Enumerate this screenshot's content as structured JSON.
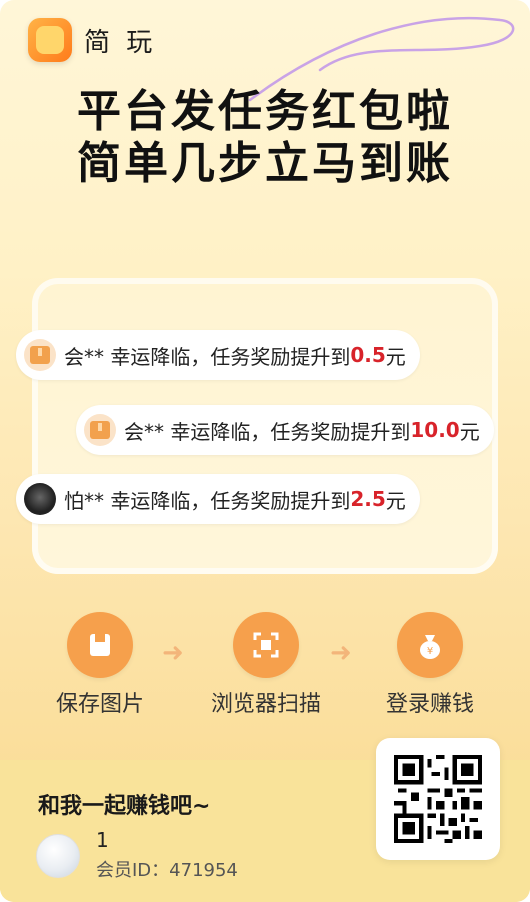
{
  "brand": {
    "name": "简 玩",
    "logo_icon": "app-logo-icon"
  },
  "headline": {
    "line1": "平台发任务红包啦",
    "line2": "简单几步立马到账"
  },
  "notifications": [
    {
      "icon": "package-icon",
      "text": "会** 幸运降临，任务奖励提升到",
      "amount": "0.5",
      "unit": "元"
    },
    {
      "icon": "package-icon",
      "text": "会** 幸运降临，任务奖励提升到",
      "amount": "10.0",
      "unit": "元"
    },
    {
      "icon": "user-avatar-icon",
      "text": "怕** 幸运降临，任务奖励提升到",
      "amount": "2.5",
      "unit": "元"
    }
  ],
  "steps": [
    {
      "label": "保存图片",
      "icon": "save-image-icon"
    },
    {
      "label": "浏览器扫描",
      "icon": "scan-icon"
    },
    {
      "label": "登录赚钱",
      "icon": "money-bag-icon"
    }
  ],
  "bottom": {
    "title": "和我一起赚钱吧~",
    "username": "1",
    "member_id": "会员ID：471954"
  },
  "qr": {
    "icon": "qr-code-icon"
  },
  "colors": {
    "accent": "#f6a04c",
    "amount": "#d8232a",
    "bottom_bg": "#f9e39a"
  }
}
